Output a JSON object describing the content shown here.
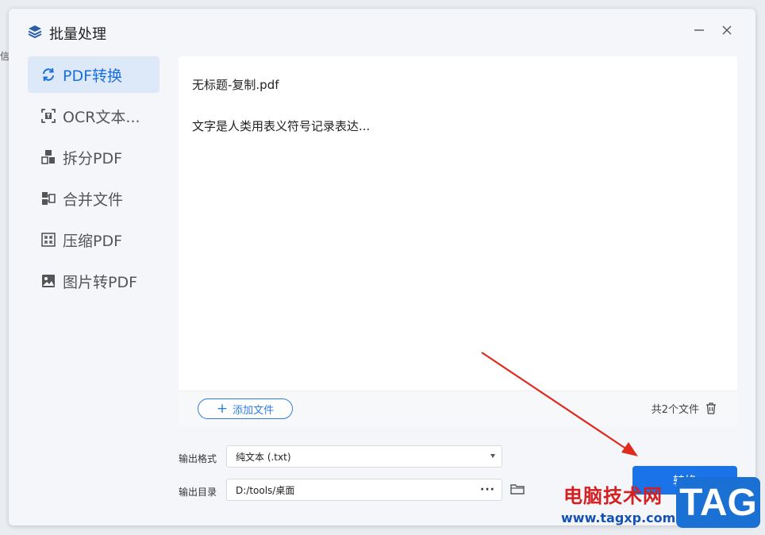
{
  "background": {
    "cut_text": "信"
  },
  "window": {
    "title": "批量处理",
    "icon": "layers-icon",
    "minimize_icon": "minimize-icon",
    "close_icon": "close-icon"
  },
  "sidebar": {
    "items": [
      {
        "label": "PDF转换",
        "icon": "convert-icon",
        "active": true
      },
      {
        "label": "OCR文本...",
        "icon": "ocr-text-icon",
        "active": false
      },
      {
        "label": "拆分PDF",
        "icon": "split-icon",
        "active": false
      },
      {
        "label": "合并文件",
        "icon": "merge-icon",
        "active": false
      },
      {
        "label": "压缩PDF",
        "icon": "compress-icon",
        "active": false
      },
      {
        "label": "图片转PDF",
        "icon": "image-to-pdf-icon",
        "active": false
      }
    ]
  },
  "files": {
    "items": [
      {
        "name": "无标题-复制.pdf"
      },
      {
        "name": "文字是人类用表义符号记录表达..."
      }
    ],
    "add_button": "添加文件",
    "count_text": "共2个文件"
  },
  "output": {
    "format_label": "输出格式",
    "format_value": "纯文本 (.txt)",
    "dir_label": "输出目录",
    "dir_value": "D:/tools/桌面",
    "more": "···"
  },
  "convert_button": "转换",
  "watermark": {
    "site_name": "电脑技术网",
    "url": "www.tagxp.com",
    "tag": "TAG"
  },
  "colors": {
    "accent": "#1a73e8",
    "active_bg": "#dde9f9",
    "arrow": "#e02a1d"
  }
}
